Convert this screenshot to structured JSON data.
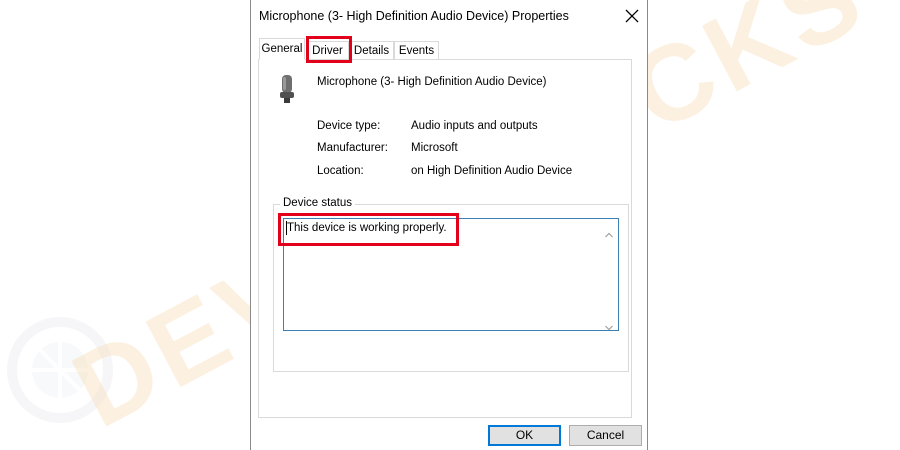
{
  "dialog": {
    "title": "Microphone (3- High Definition Audio Device) Properties",
    "close_icon": "close-icon"
  },
  "tabs": [
    {
      "label": "General",
      "active": true
    },
    {
      "label": "Driver",
      "active": false
    },
    {
      "label": "Details",
      "active": false
    },
    {
      "label": "Events",
      "active": false
    }
  ],
  "device": {
    "icon": "microphone-icon",
    "name": "Microphone (3- High Definition Audio Device)"
  },
  "properties": [
    {
      "label": "Device type:",
      "value": "Audio inputs and outputs"
    },
    {
      "label": "Manufacturer:",
      "value": "Microsoft"
    },
    {
      "label": "Location:",
      "value": "on High Definition Audio Device"
    }
  ],
  "device_status": {
    "legend": "Device status",
    "text": "This device is working properly."
  },
  "buttons": {
    "ok": "OK",
    "cancel": "Cancel"
  },
  "colors": {
    "highlight": "#e3001b",
    "status_border": "#3c7fb1",
    "ok_border": "#0078d7",
    "watermark": "#f7d7a8"
  },
  "watermark_text": "DEVICETRICKS"
}
